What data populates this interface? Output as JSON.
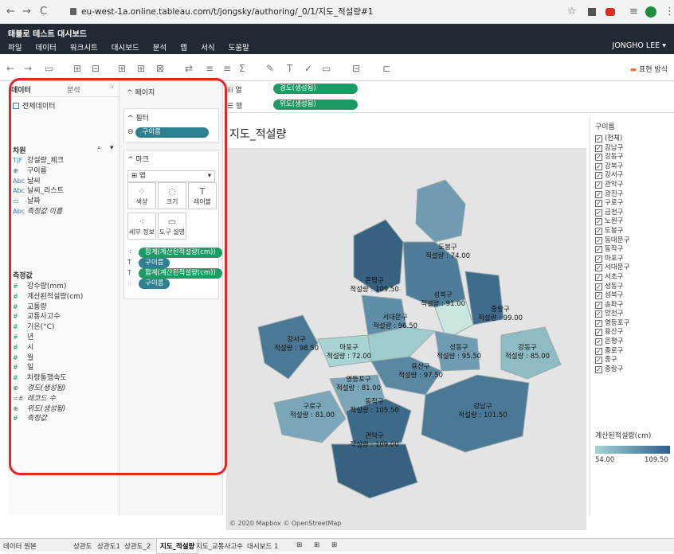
{
  "browser": {
    "url": "eu-west-1a.online.tableau.com/t/jongsky/authoring/_0/1/지도_적설량#1"
  },
  "app": {
    "title": "태블로 테스트 대시보드",
    "menu": [
      "파일",
      "데이터",
      "워크시트",
      "대시보드",
      "분석",
      "맵",
      "서식",
      "도움말"
    ],
    "user": "JONGHO LEE",
    "presentation": "표현 방식"
  },
  "left": {
    "tab_data": "데이터",
    "tab_analysis": "분석",
    "datasource": "전체데이터",
    "dimensions_title": "차원",
    "dimensions": [
      {
        "icon": "T|F",
        "label": "강설량_체크"
      },
      {
        "icon": "⊕",
        "label": "구이름"
      },
      {
        "icon": "Abc",
        "label": "날씨"
      },
      {
        "icon": "Abc",
        "label": "날씨_리스트"
      },
      {
        "icon": "▭",
        "label": "날짜"
      },
      {
        "icon": "Abc",
        "label": "측정값 이름",
        "italic": true
      }
    ],
    "measures_title": "측정값",
    "measures": [
      {
        "icon": "#",
        "label": "강수량(mm)"
      },
      {
        "icon": "#",
        "label": "계산된적설량(cm)"
      },
      {
        "icon": "#",
        "label": "교통량"
      },
      {
        "icon": "#",
        "label": "교통사고수"
      },
      {
        "icon": "#",
        "label": "기온(°C)"
      },
      {
        "icon": "#",
        "label": "년"
      },
      {
        "icon": "#",
        "label": "시"
      },
      {
        "icon": "#",
        "label": "월"
      },
      {
        "icon": "#",
        "label": "일"
      },
      {
        "icon": "#",
        "label": "차량통행속도"
      },
      {
        "icon": "⊕",
        "label": "경도(생성됨)",
        "italic": true
      },
      {
        "icon": "=#",
        "label": "레코드 수",
        "italic": true
      },
      {
        "icon": "⊕",
        "label": "위도(생성됨)",
        "italic": true
      },
      {
        "icon": "#",
        "label": "측정값",
        "italic": true
      }
    ]
  },
  "mid": {
    "pages": "페이지",
    "filters": "필터",
    "filter_pill": "구이름",
    "marks": "마크",
    "mark_type": "맵",
    "buttons": [
      {
        "icon": "⁘",
        "label": "색상"
      },
      {
        "icon": "◌",
        "label": "크기"
      },
      {
        "icon": "T",
        "label": "레이블"
      },
      {
        "icon": "⁖",
        "label": "세부 정보"
      },
      {
        "icon": "▭",
        "label": "도구 설명"
      }
    ],
    "mark_fields": [
      {
        "icon": "⁘",
        "label": "합계(계산된적설량(cm))",
        "green": true
      },
      {
        "icon": "T",
        "label": "구이름",
        "green": false
      },
      {
        "icon": "T",
        "label": "합계(계산된적설량(cm))",
        "green": true
      },
      {
        "icon": "⁖",
        "label": "구이름",
        "green": false
      }
    ]
  },
  "shelves": {
    "columns_label": "열",
    "columns_pill": "경도(생성됨)",
    "rows_label": "행",
    "rows_pill": "위도(생성됨)"
  },
  "sheet": {
    "title": "지도_적설량",
    "copyright": "© 2020 Mapbox © OpenStreetMap"
  },
  "map_labels": [
    {
      "name": "도봉구",
      "value": "적설량 : 74.00"
    },
    {
      "name": "은평구",
      "value": "적설량 : 109.50"
    },
    {
      "name": "성북구",
      "value": "적설량 : 91.00"
    },
    {
      "name": "중랑구",
      "value": "적설량 : 99.00"
    },
    {
      "name": "서대문구",
      "value": "적설량 : 96.50"
    },
    {
      "name": "강서구",
      "value": "적설량 : 98.50"
    },
    {
      "name": "마포구",
      "value": "적설량 : 72.00"
    },
    {
      "name": "성동구",
      "value": "적설량 : 95.50"
    },
    {
      "name": "강동구",
      "value": "적설량 : 85.00"
    },
    {
      "name": "용산구",
      "value": "적설량 : 97.50"
    },
    {
      "name": "영등포구",
      "value": "적설량 : 81.00"
    },
    {
      "name": "구로구",
      "value": "적설량 : 81.00"
    },
    {
      "name": "동작구",
      "value": "적설량 : 105.50"
    },
    {
      "name": "강남구",
      "value": "적설량 : 101.50"
    },
    {
      "name": "관악구",
      "value": "적설량 : 109.00"
    }
  ],
  "legend": {
    "title": "구이름",
    "items": [
      "(전체)",
      "강남구",
      "강동구",
      "강북구",
      "강서구",
      "관악구",
      "광진구",
      "구로구",
      "금천구",
      "노원구",
      "도봉구",
      "동대문구",
      "동작구",
      "마포구",
      "서대문구",
      "서초구",
      "성동구",
      "성북구",
      "송파구",
      "양천구",
      "영등포구",
      "용산구",
      "은평구",
      "종로구",
      "중구",
      "중랑구"
    ],
    "color_title": "계산된적설량(cm)",
    "color_min": "54.00",
    "color_max": "109.50"
  },
  "bottom_tabs": [
    "데이터 원본",
    "상관도",
    "상관도1",
    "상관도_2",
    "지도_적설량",
    "지도_교통사고수",
    "대시보드 1"
  ],
  "active_tab": "지도_적설량"
}
